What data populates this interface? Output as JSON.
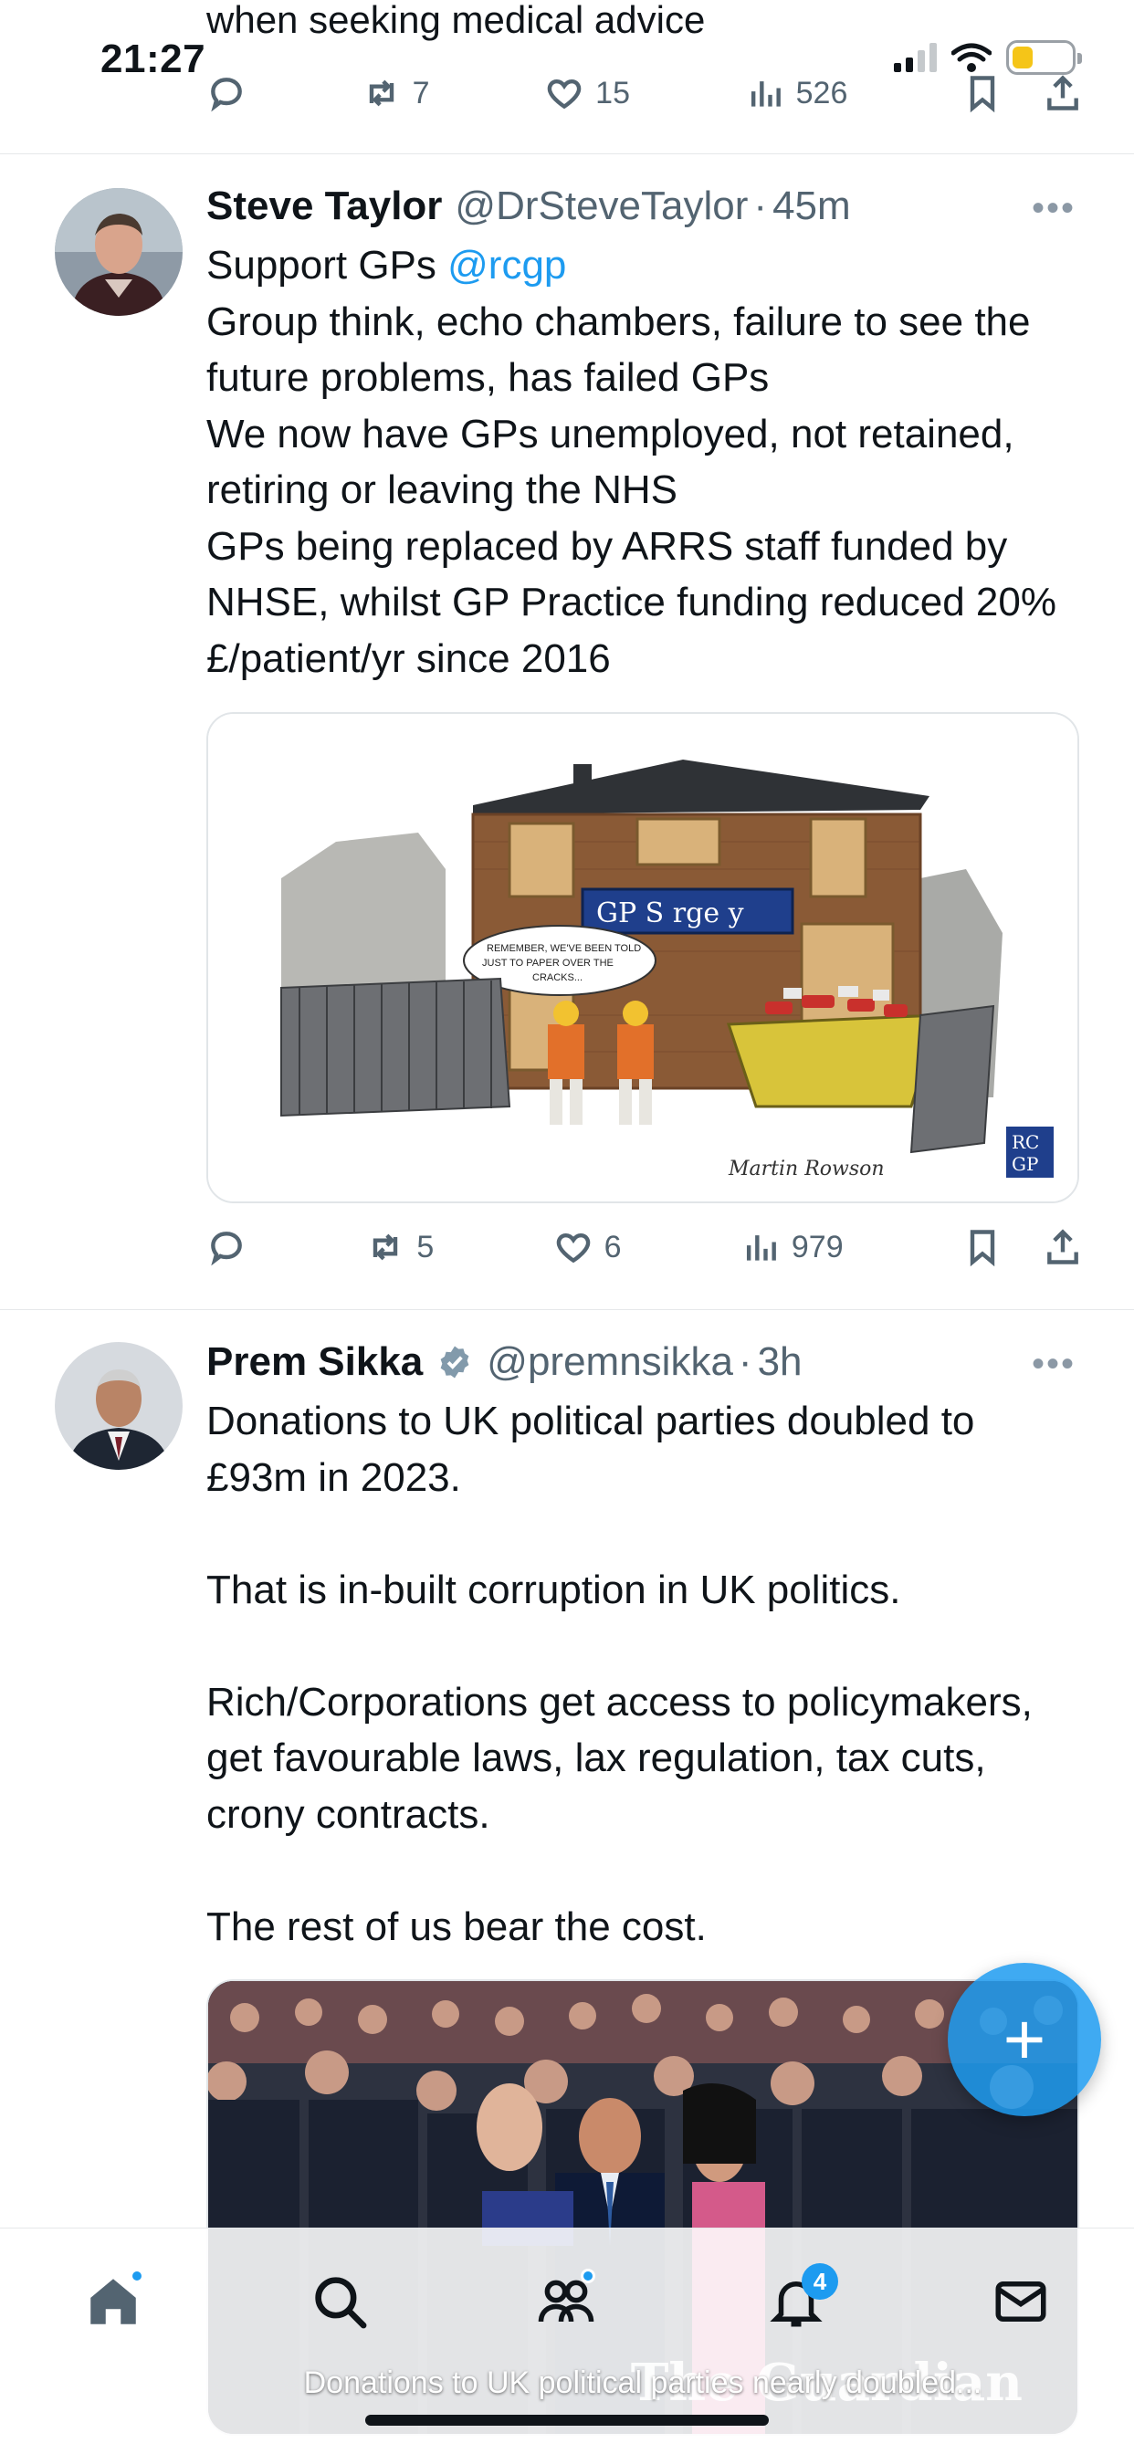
{
  "status_bar": {
    "time": "21:27"
  },
  "prev_tweet": {
    "text_tail": "when seeking medical advice",
    "actions": {
      "replies": "",
      "reposts": "7",
      "likes": "15",
      "views": "526"
    }
  },
  "tweets": [
    {
      "name": "Steve Taylor",
      "handle": "@DrSteveTaylor",
      "time": "45m",
      "verified": false,
      "text_prefix": "Support GPs ",
      "mention": "@rcgp",
      "text_body": "Group think, echo chambers, failure to see the future problems, has failed GPs\nWe now have GPs unemployed, not retained, retiring or leaving the NHS\nGPs being replaced by ARRS staff funded by NHSE, whilst GP Practice funding reduced 20% £/patient/yr since 2016",
      "media": {
        "sign_text": "GP S rge y",
        "speech_text": "REMEMBER, WE'VE BEEN TOLD JUST TO PAPER OVER THE CRACKS...",
        "logo_text": "RC GP",
        "signature": "Martin Rowson"
      },
      "actions": {
        "replies": "",
        "reposts": "5",
        "likes": "6",
        "views": "979"
      }
    },
    {
      "name": "Prem Sikka",
      "handle": "@premnsikka",
      "time": "3h",
      "verified": true,
      "text": "Donations to UK political parties doubled to £93m in 2023.\n\nThat is in-built corruption in UK politics.\n\nRich/Corporations get access to policymakers, get favourable laws, lax regulation, tax cuts, crony contracts.\n\nThe rest of us bear the cost.",
      "media": {
        "caption": "Donations to UK political parties nearly doubled...",
        "logo": "The Guardian"
      }
    }
  ],
  "bottom_nav": {
    "items": [
      "home-icon",
      "search-icon",
      "communities-icon",
      "notifications-icon",
      "messages-icon"
    ],
    "notifications_count": "4"
  },
  "fab": {
    "label": "+"
  },
  "colors": {
    "accent": "#1d9bf0",
    "text": "#0f1419",
    "muted": "#536471"
  }
}
